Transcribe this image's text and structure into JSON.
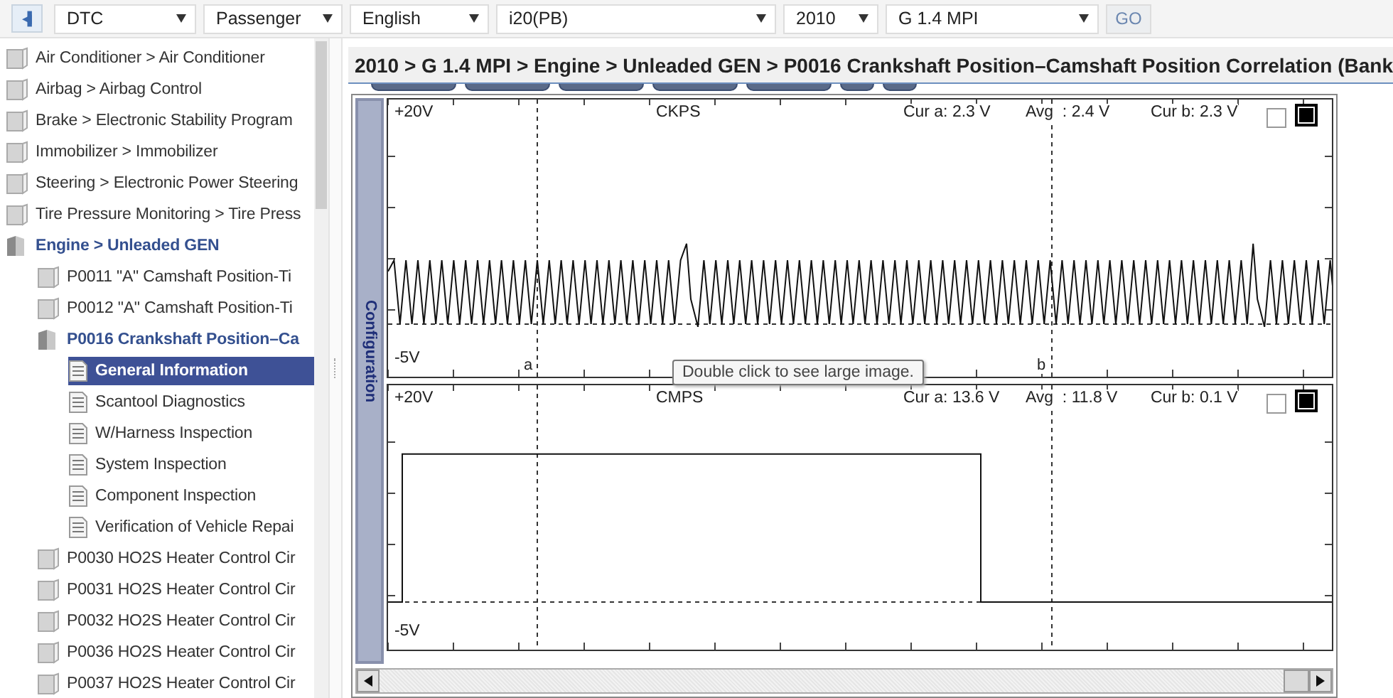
{
  "toolbar": {
    "collapse_button": "◀▌",
    "selects": [
      {
        "value": "DTC"
      },
      {
        "value": "Passenger"
      },
      {
        "value": "English"
      },
      {
        "value": "i20(PB)"
      },
      {
        "value": "2010"
      },
      {
        "value": "G 1.4 MPI"
      }
    ],
    "go_button": "GO"
  },
  "tree": [
    {
      "label": "Air Conditioner > Air Conditioner",
      "kind": "book",
      "expanded": false,
      "selected": false
    },
    {
      "label": "Airbag > Airbag Control",
      "kind": "book",
      "expanded": false,
      "selected": false
    },
    {
      "label": "Brake > Electronic Stability Program",
      "kind": "book",
      "expanded": false,
      "selected": false
    },
    {
      "label": "Immobilizer > Immobilizer",
      "kind": "book",
      "expanded": false,
      "selected": false
    },
    {
      "label": "Steering > Electronic Power Steering",
      "kind": "book",
      "expanded": false,
      "selected": false
    },
    {
      "label": "Tire Pressure Monitoring > Tire Press",
      "kind": "book",
      "expanded": false,
      "selected": false
    },
    {
      "label": "Engine > Unleaded GEN",
      "kind": "book",
      "expanded": true,
      "selected": false,
      "children": [
        {
          "label": "P0011 \"A\" Camshaft Position-Ti",
          "kind": "book",
          "expanded": false,
          "selected": false
        },
        {
          "label": "P0012 \"A\" Camshaft Position-Ti",
          "kind": "book",
          "expanded": false,
          "selected": false
        },
        {
          "label": "P0016 Crankshaft Position–Ca",
          "kind": "book",
          "expanded": true,
          "selected": false,
          "children": [
            {
              "label": "General Information",
              "kind": "page",
              "selected": true
            },
            {
              "label": "Scantool Diagnostics",
              "kind": "page",
              "selected": false
            },
            {
              "label": "W/Harness Inspection",
              "kind": "page",
              "selected": false
            },
            {
              "label": "System Inspection",
              "kind": "page",
              "selected": false
            },
            {
              "label": "Component Inspection",
              "kind": "page",
              "selected": false
            },
            {
              "label": "Verification of Vehicle Repai",
              "kind": "page",
              "selected": false
            }
          ]
        },
        {
          "label": "P0030 HO2S Heater Control Cir",
          "kind": "book",
          "expanded": false,
          "selected": false
        },
        {
          "label": "P0031 HO2S Heater Control Cir",
          "kind": "book",
          "expanded": false,
          "selected": false
        },
        {
          "label": "P0032 HO2S Heater Control Cir",
          "kind": "book",
          "expanded": false,
          "selected": false
        },
        {
          "label": "P0036 HO2S Heater Control Cir",
          "kind": "book",
          "expanded": false,
          "selected": false
        },
        {
          "label": "P0037 HO2S Heater Control Cir",
          "kind": "book",
          "expanded": false,
          "selected": false
        }
      ]
    }
  ],
  "breadcrumb": "2010 > G 1.4 MPI > Engine > Unleaded GEN > P0016 Crankshaft Position–Camshaft Position Correlation (Bank",
  "scope": {
    "config_tab": "Configuration",
    "channels": [
      {
        "name": "CKPS",
        "kind": "oscillating",
        "top_label": "+20V",
        "bottom_label": "-5V",
        "cur_a": "Cur a: 2.3 V",
        "avg": "Avg  : 2.4 V",
        "cur_b": "Cur b: 2.3 V",
        "cursor_labels": [
          "a",
          "b"
        ],
        "checked": false
      },
      {
        "name": "CMPS",
        "kind": "square",
        "top_label": "+20V",
        "bottom_label": "-5V",
        "cur_a": "Cur a: 13.6 V",
        "avg": "Avg  : 11.8 V",
        "cur_b": "Cur b: 0.1 V",
        "checked": false
      }
    ]
  },
  "tooltip": "Double click to see large image."
}
